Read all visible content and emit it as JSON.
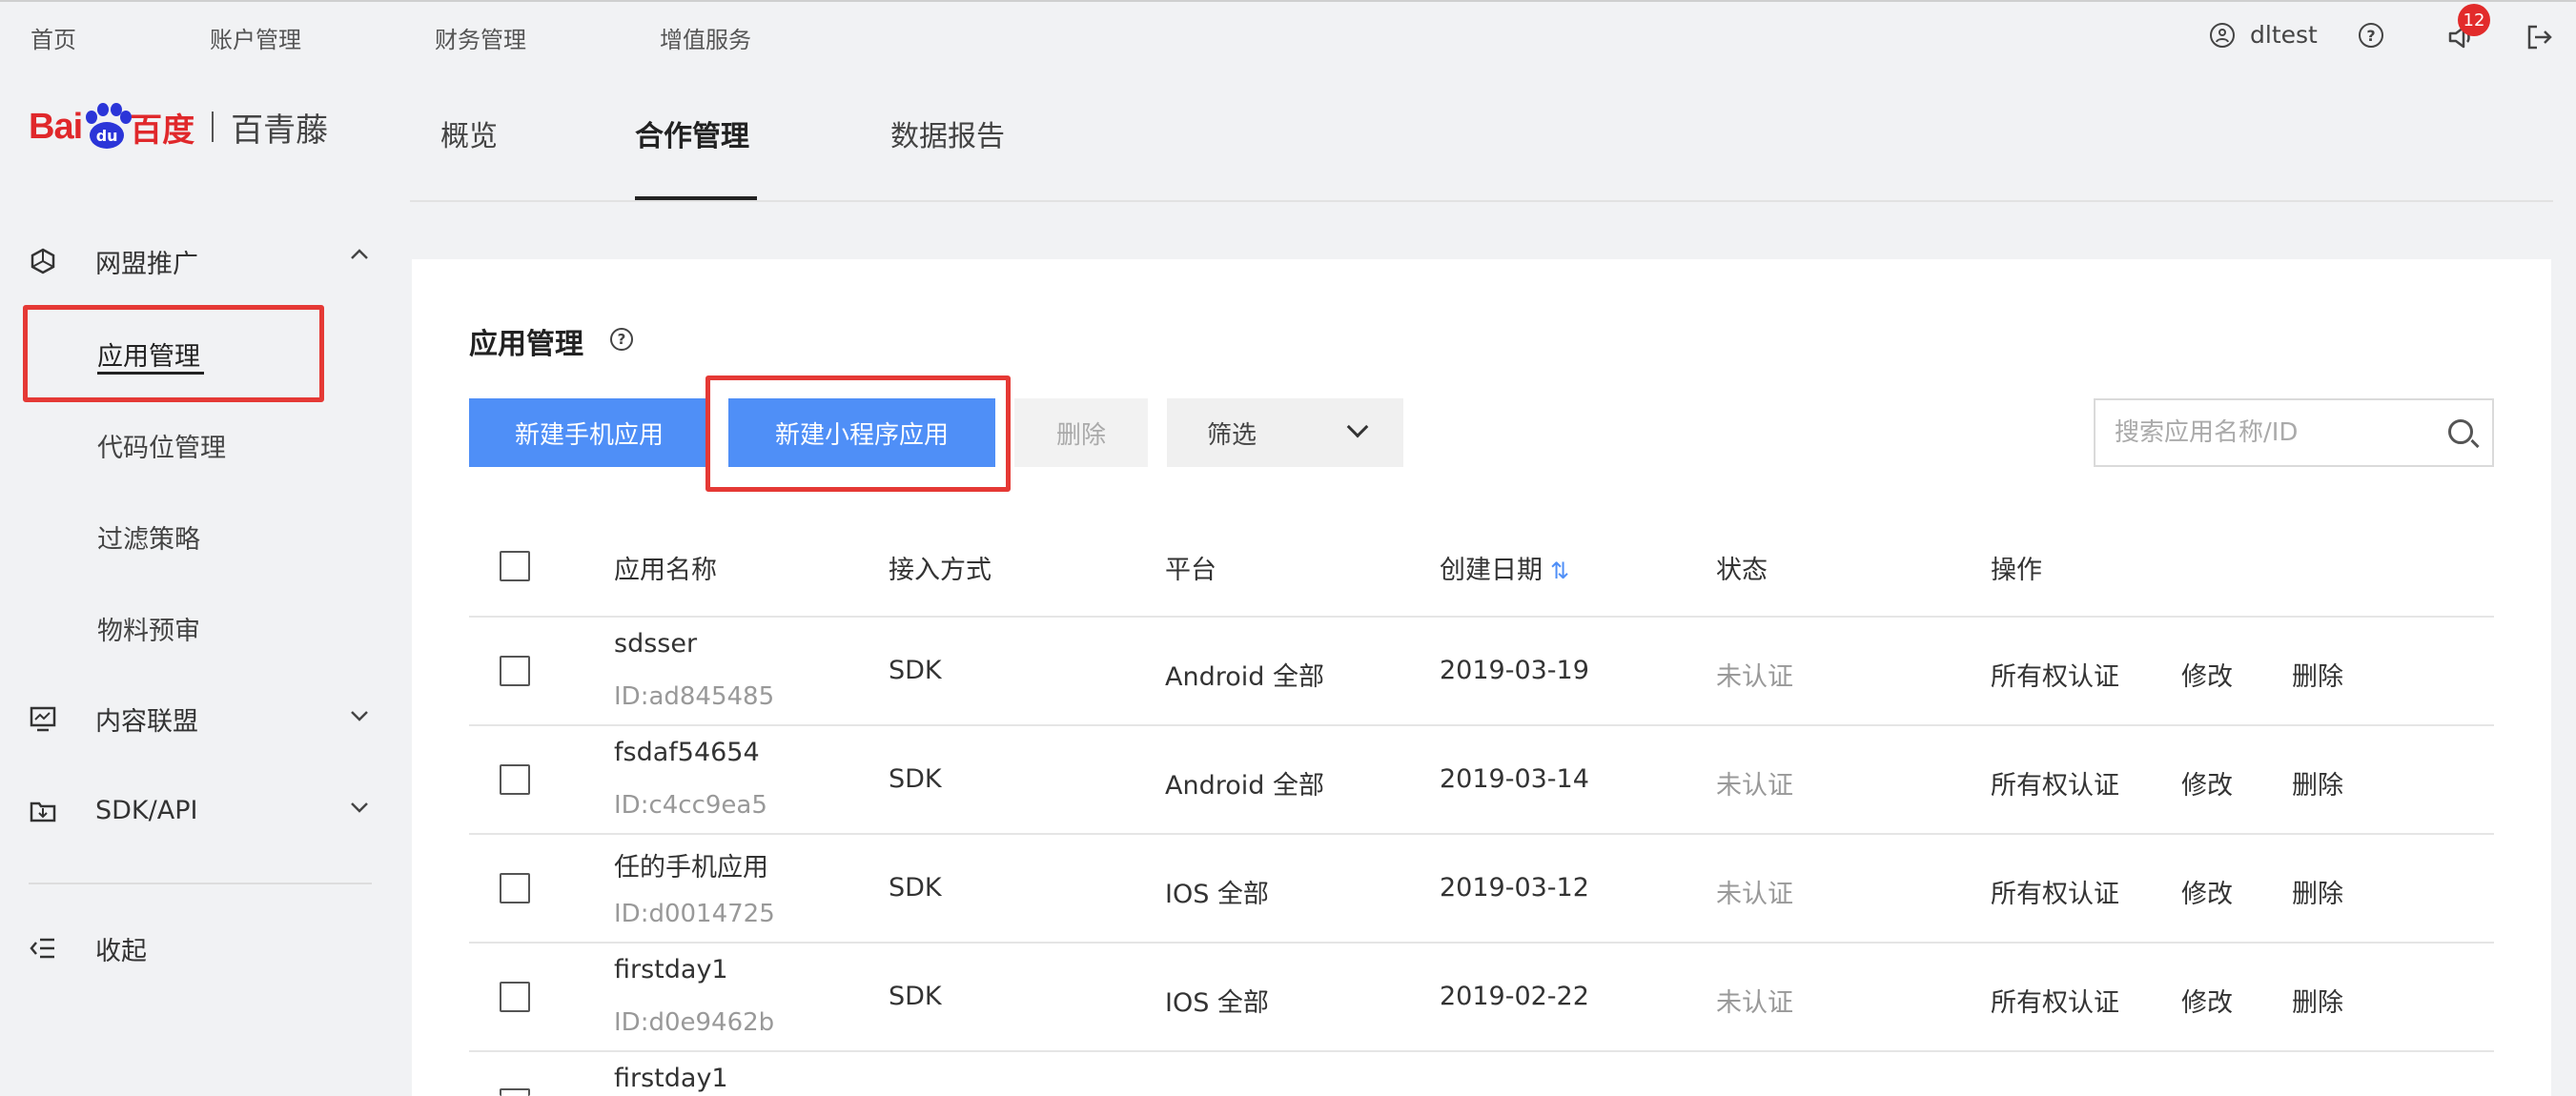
{
  "topbar": {
    "nav": [
      "首页",
      "账户管理",
      "财务管理",
      "增值服务"
    ],
    "username": "dltest",
    "notification_count": "12"
  },
  "brand": {
    "logo_bai": "Bai",
    "logo_du": "du",
    "logo_cn": "百度",
    "product_name": "百青藤"
  },
  "mainnav": {
    "items": [
      "概览",
      "合作管理",
      "数据报告"
    ],
    "active": "合作管理"
  },
  "sidebar": {
    "group_alliance": "网盟推广",
    "items": [
      "应用管理",
      "代码位管理",
      "过滤策略",
      "物料预审"
    ],
    "group_content": "内容联盟",
    "group_sdk": "SDK/API",
    "collapse": "收起"
  },
  "main": {
    "title": "应用管理",
    "buttons": {
      "new_mobile": "新建手机应用",
      "new_miniprogram": "新建小程序应用",
      "delete": "删除",
      "filter": "筛选"
    },
    "search": {
      "placeholder": "搜索应用名称/ID"
    },
    "table": {
      "headers": [
        "应用名称",
        "接入方式",
        "平台",
        "创建日期",
        "状态",
        "操作"
      ],
      "actions": [
        "所有权认证",
        "修改",
        "删除"
      ],
      "rows": [
        {
          "name": "sdsser",
          "id": "ID:ad845485",
          "access": "SDK",
          "platform": "Android 全部",
          "date": "2019-03-19",
          "status": "未认证"
        },
        {
          "name": "fsdaf54654",
          "id": "ID:c4cc9ea5",
          "access": "SDK",
          "platform": "Android 全部",
          "date": "2019-03-14",
          "status": "未认证"
        },
        {
          "name": "任的手机应用",
          "id": "ID:d0014725",
          "access": "SDK",
          "platform": "IOS 全部",
          "date": "2019-03-12",
          "status": "未认证"
        },
        {
          "name": "firstday1",
          "id": "ID:d0e9462b",
          "access": "SDK",
          "platform": "IOS 全部",
          "date": "2019-02-22",
          "status": "未认证"
        },
        {
          "name": "firstday1",
          "id": "",
          "access": "",
          "platform": "",
          "date": "",
          "status": ""
        }
      ]
    }
  },
  "colors": {
    "primary": "#4f8ff7",
    "highlight": "#e53935",
    "badge": "#e22b2b",
    "logo_red": "#e0282b",
    "logo_blue": "#2b35d8"
  }
}
